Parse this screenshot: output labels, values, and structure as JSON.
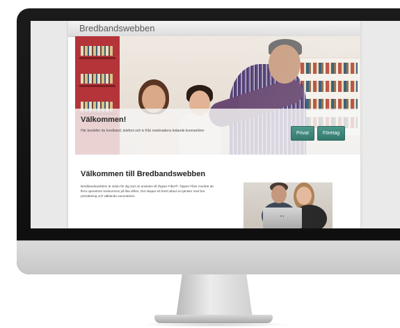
{
  "site": {
    "title": "Bredbandswebben"
  },
  "hero": {
    "welcome_title": "Välkommen!",
    "welcome_text": "Här beställer du bredband, telefoni och tv från marknadens ledande leverantörer",
    "buttons": [
      "Privat",
      "Företag"
    ]
  },
  "content": {
    "title": "Välkommen till Bredbandswebben",
    "paragraph": "Bredbandswebben är sidan för dig som är ansluten till Öppen Fiber®. Öppen Fiber innebär att flera operatörer konkurrerar på lika villkor. Det skapar ett brett utbud av tjänster med bra prissättning och välkända varumärken."
  },
  "colors": {
    "button_green": "#2f7f73",
    "monitor_bezel": "#111111",
    "chin_silver": "#d0d0d0"
  }
}
